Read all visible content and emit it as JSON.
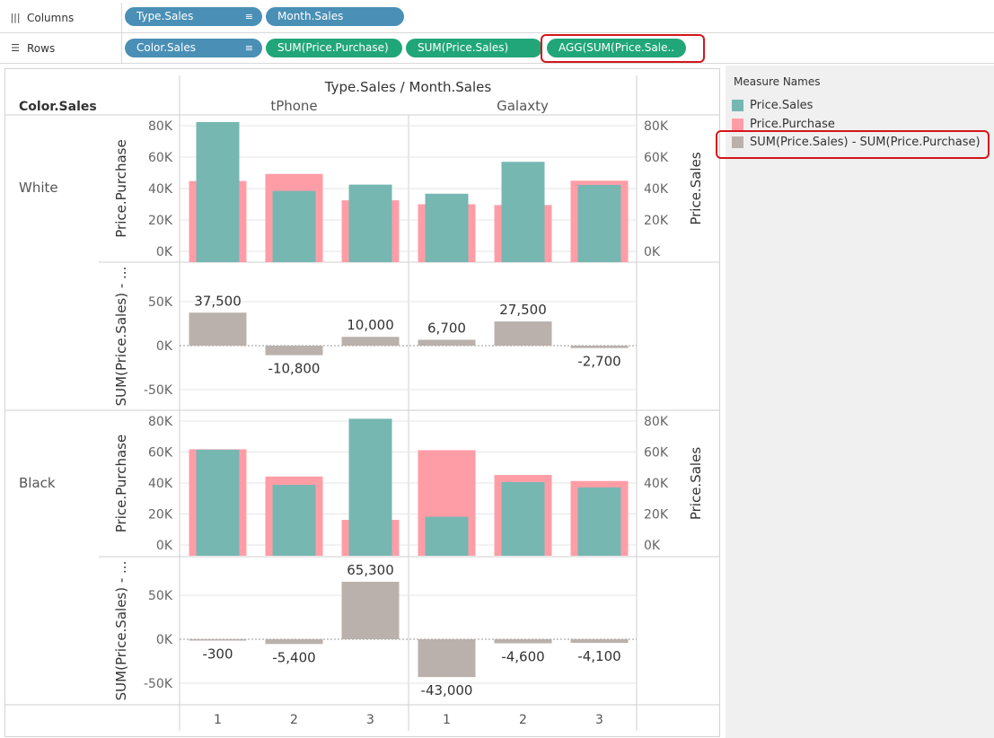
{
  "shelves": {
    "columns": {
      "label": "Columns",
      "pills": [
        "Type.Sales",
        "Month.Sales"
      ]
    },
    "rows": {
      "label": "Rows",
      "pills": [
        "Color.Sales",
        "SUM(Price.Purchase)",
        "SUM(Price.Sales)",
        "AGG(SUM(Price.Sale.."
      ]
    }
  },
  "legend": {
    "title": "Measure Names",
    "items": [
      {
        "label": "Price.Sales",
        "color": "#76b7b2"
      },
      {
        "label": "Price.Purchase",
        "color": "#ff9da7"
      },
      {
        "label": "SUM(Price.Sales) - SUM(Price.Purchase)",
        "color": "#bab0ac"
      }
    ]
  },
  "chart_data": {
    "type": "bar",
    "header": "Type.Sales / Month.Sales",
    "row_header": "Color.Sales",
    "types": [
      "tPhone",
      "Galaxty"
    ],
    "months": [
      "1",
      "2",
      "3"
    ],
    "colors": [
      "White",
      "Black"
    ],
    "axis_labels": {
      "left_top": "Price.Purchase",
      "right_top": "Price.Sales",
      "left_bottom": "SUM(Price.Sales) - ..."
    },
    "top_ylim": [
      0,
      85000
    ],
    "top_ticks": [
      0,
      20000,
      40000,
      60000,
      80000
    ],
    "top_tick_labels": [
      "0K",
      "20K",
      "40K",
      "60K",
      "80K"
    ],
    "diff_ylim": [
      -60000,
      60000
    ],
    "diff_ticks": [
      -50000,
      0,
      50000
    ],
    "diff_tick_labels": [
      "-50K",
      "0K",
      "50K"
    ],
    "series_colors": {
      "sales": "#76b7b2",
      "purchase": "#ff9da7",
      "diff": "#bab0ac"
    },
    "series": [
      {
        "color": "White",
        "purchase": [
          44800,
          49300,
          32500,
          30000,
          29500,
          45000
        ],
        "sales": [
          82300,
          38500,
          42500,
          36700,
          57000,
          42300
        ],
        "diff": [
          37500,
          -10800,
          10000,
          6700,
          27500,
          -2700
        ],
        "diff_labels": [
          "37,500",
          "-10,800",
          "10,000",
          "6,700",
          "27,500",
          "-2,700"
        ]
      },
      {
        "color": "Black",
        "purchase": [
          61800,
          44200,
          16200,
          61200,
          45200,
          41300
        ],
        "sales": [
          61500,
          38800,
          81500,
          18200,
          40600,
          37200
        ],
        "diff": [
          -300,
          -5400,
          65300,
          -43000,
          -4600,
          -4100
        ],
        "diff_labels": [
          "-300",
          "-5,400",
          "65,300",
          "-43,000",
          "-4,600",
          "-4,100"
        ]
      }
    ]
  }
}
